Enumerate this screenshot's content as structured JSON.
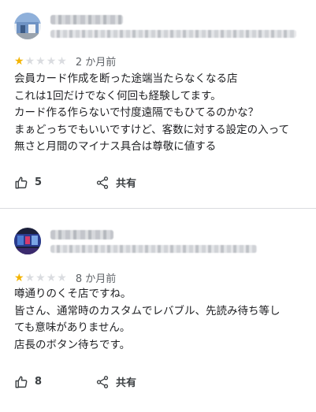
{
  "reviews": [
    {
      "stars": 1,
      "max_stars": 5,
      "when": "2 か月前",
      "text": "会員カード作成を断った途端当たらなくなる店\nこれは1回だけでなく何回も経験してます。\nカード作る作らないで忖度遠隔でもひてるのかな？\nまぁどっちでもいいですけど、客数に対する設定の入って\n無さと月間のマイナス具合は尊敬に値する",
      "likes": "5",
      "share_label": "共有",
      "avatar_colors": [
        "#6f93c4",
        "#e8edf3",
        "#3c5b86"
      ]
    },
    {
      "stars": 1,
      "max_stars": 5,
      "when": "8 か月前",
      "text": "噂通りのくそ店ですね。\n皆さん、通常時のカスタムでレバブル、先読み待ち等し\nても意味がありません。\n店長のボタン待ちです。",
      "likes": "8",
      "share_label": "共有",
      "avatar_colors": [
        "#2a3b8f",
        "#d33a6b",
        "#1b1f3a"
      ]
    }
  ],
  "icons": {
    "star": "★",
    "like": "thumb-up-icon",
    "share": "share-icon"
  },
  "colors": {
    "star_on": "#f4b400",
    "star_off": "#dadce0",
    "divider": "#dadce0"
  }
}
